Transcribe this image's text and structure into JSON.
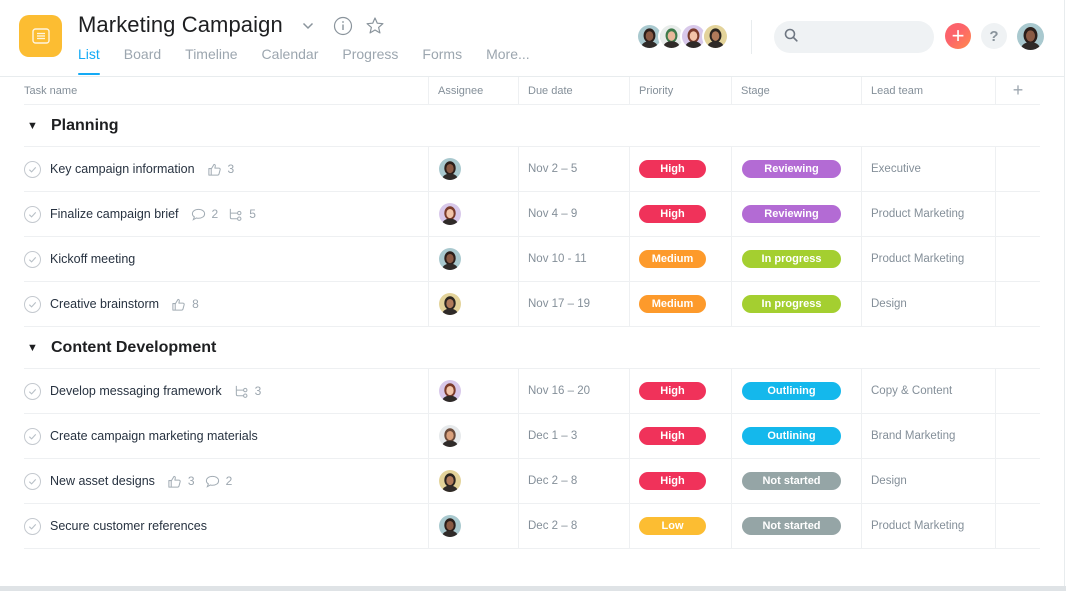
{
  "header": {
    "project_icon": "list-icon",
    "project_color": "#fcbd32",
    "title": "Marketing Campaign",
    "tabs": [
      {
        "label": "List",
        "active": true
      },
      {
        "label": "Board",
        "active": false
      },
      {
        "label": "Timeline",
        "active": false
      },
      {
        "label": "Calendar",
        "active": false
      },
      {
        "label": "Progress",
        "active": false
      },
      {
        "label": "Forms",
        "active": false
      },
      {
        "label": "More...",
        "active": false
      }
    ],
    "members": [
      "member-1",
      "member-2",
      "member-3",
      "member-4"
    ],
    "search": {
      "value": "",
      "placeholder": ""
    },
    "help_label": "?",
    "add_label": "+"
  },
  "table": {
    "columns": [
      "Task name",
      "Assignee",
      "Due date",
      "Priority",
      "Stage",
      "Lead team"
    ],
    "add_column_label": "+",
    "sections": [
      {
        "title": "Planning",
        "tasks": [
          {
            "name": "Key campaign information",
            "likes": "3",
            "comments": null,
            "subtasks": null,
            "assignee": "a",
            "due": "Nov 2 – 5",
            "priority": "High",
            "stage": "Reviewing",
            "team": "Executive"
          },
          {
            "name": "Finalize campaign brief",
            "likes": null,
            "comments": "2",
            "subtasks": "5",
            "assignee": "c",
            "due": "Nov 4 – 9",
            "priority": "High",
            "stage": "Reviewing",
            "team": "Product Marketing"
          },
          {
            "name": "Kickoff meeting",
            "likes": null,
            "comments": null,
            "subtasks": null,
            "assignee": "a",
            "due": "Nov 10 - 11",
            "priority": "Medium",
            "stage": "In progress",
            "team": "Product Marketing"
          },
          {
            "name": "Creative brainstorm",
            "likes": "8",
            "comments": null,
            "subtasks": null,
            "assignee": "d",
            "due": "Nov 17 – 19",
            "priority": "Medium",
            "stage": "In progress",
            "team": "Design"
          }
        ]
      },
      {
        "title": "Content Development",
        "tasks": [
          {
            "name": "Develop messaging framework",
            "likes": null,
            "comments": null,
            "subtasks": "3",
            "assignee": "c",
            "due": "Nov 16 – 20",
            "priority": "High",
            "stage": "Outlining",
            "team": "Copy & Content"
          },
          {
            "name": "Create campaign marketing materials",
            "likes": null,
            "comments": null,
            "subtasks": null,
            "assignee": "e",
            "due": "Dec 1 – 3",
            "priority": "High",
            "stage": "Outlining",
            "team": "Brand Marketing"
          },
          {
            "name": "New asset designs",
            "likes": "3",
            "comments": "2",
            "subtasks": null,
            "assignee": "d",
            "due": "Dec 2 – 8",
            "priority": "High",
            "stage": "Not started",
            "team": "Design"
          },
          {
            "name": "Secure customer references",
            "likes": null,
            "comments": null,
            "subtasks": null,
            "assignee": "a",
            "due": "Dec 2 – 8",
            "priority": "Low",
            "stage": "Not started",
            "team": "Product Marketing"
          }
        ]
      }
    ]
  },
  "colors": {
    "accent": "#14aaf5",
    "priority": {
      "High": "#f0325a",
      "Medium": "#fd9a2b",
      "Low": "#fcbd32"
    },
    "stage": {
      "Reviewing": "#b36bd4",
      "In progress": "#a4cf30",
      "Outlining": "#14b8ec",
      "Not started": "#95a5a6"
    },
    "avatars": {
      "a": {
        "bg": "#a9c9cf",
        "hair": "#2b1e1a",
        "skin": "#8a5a44"
      },
      "b": {
        "bg": "#e8ecea",
        "hair": "#3d7a4a",
        "skin": "#e8b89a"
      },
      "c": {
        "bg": "#d8c8ea",
        "hair": "#7a3b2a",
        "skin": "#f2c4a8"
      },
      "d": {
        "bg": "#e3d39a",
        "hair": "#2a2420",
        "skin": "#b07a5a"
      },
      "e": {
        "bg": "#e6e9eb",
        "hair": "#6a4a3a",
        "skin": "#d9a07c"
      }
    }
  }
}
